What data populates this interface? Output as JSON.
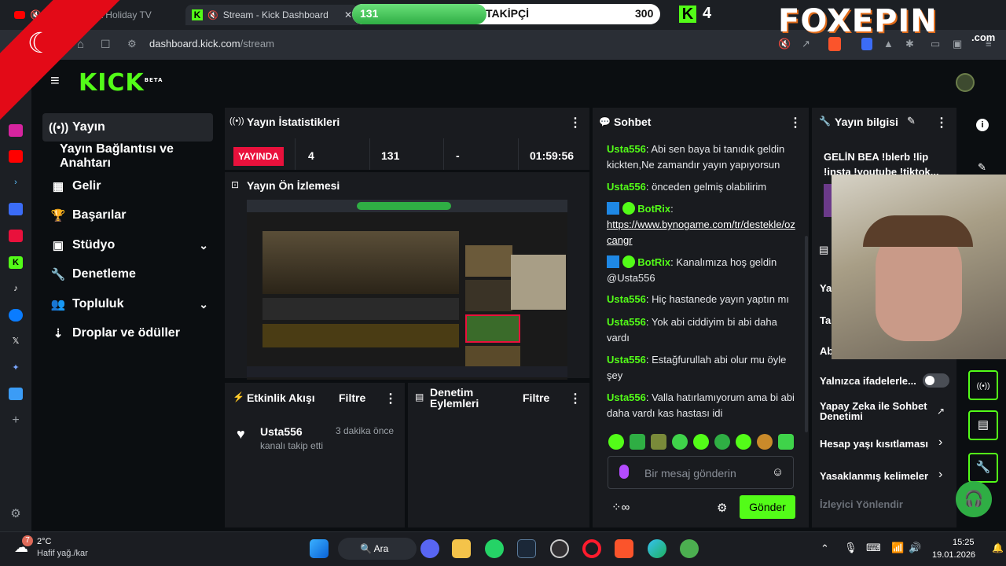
{
  "browser": {
    "tab1_title": "edicta Holiday TV",
    "tab2_title": "Stream - Kick Dashboard",
    "url_host": "dashboard.kick.com",
    "url_path": "/stream"
  },
  "overlay": {
    "follower_current": "131",
    "follower_label": "TAKİPÇİ",
    "follower_goal": "300",
    "follower_progress": 0.4367,
    "kick_count": "4",
    "brand": "FOXEPIN",
    "brand_domain": ".com"
  },
  "kick": {
    "logo": "KICK",
    "logo_badge": "BETA"
  },
  "nav": [
    {
      "label": "Yayın",
      "icon": "broadcast-icon"
    },
    {
      "label": "Yayın Bağlantısı ve Anahtarı",
      "icon": ""
    },
    {
      "label": "Gelir",
      "icon": "chart-icon"
    },
    {
      "label": "Başarılar",
      "icon": "trophy-icon"
    },
    {
      "label": "Stüdyo",
      "icon": "studio-icon"
    },
    {
      "label": "Denetleme",
      "icon": "wrench-icon"
    },
    {
      "label": "Topluluk",
      "icon": "community-icon"
    },
    {
      "label": "Droplar ve ödüller",
      "icon": "drops-icon"
    }
  ],
  "stats": {
    "title": "Yayın İstatistikleri",
    "live_badge": "YAYINDA",
    "viewers": "4",
    "followers": "131",
    "subs": "-",
    "duration": "01:59:56"
  },
  "preview": {
    "title": "Yayın Ön İzlemesi"
  },
  "activity": {
    "title": "Etkinlik Akışı",
    "filter": "Filtre",
    "item_user": "Usta556",
    "item_time": "3 dakika önce",
    "item_action": "kanalı takip etti"
  },
  "modactions": {
    "title_line1": "Denetim",
    "title_line2": "Eylemleri",
    "filter": "Filtre"
  },
  "chat": {
    "title": "Sohbet",
    "messages": [
      {
        "user": "Usta556",
        "text": ": Abi sen baya bi tanıdık geldin kickten,Ne zamandır yayın yapıyorsun"
      },
      {
        "user": "Usta556",
        "text": ": önceden gelmiş olabilirim"
      },
      {
        "user": "BotRix",
        "text": ":",
        "link": "https://www.bynogame.com/tr/destekle/ozcangr"
      },
      {
        "user": "BotRix",
        "text": ": Kanalımıza hoş geldin @Usta556"
      },
      {
        "user": "Usta556",
        "text": ": Hiç hastanede yayın yaptın mı"
      },
      {
        "user": "Usta556",
        "text": ": Yok abi ciddiyim bi abi daha vardı"
      },
      {
        "user": "Usta556",
        "text": ": Estağfurullah abi olur mu öyle şey"
      },
      {
        "user": "Usta556",
        "text": ": Valla hatırlamıyorum ama bi abi daha vardı kas hastası idi"
      }
    ],
    "input_placeholder": "Bir mesaj gönderin",
    "send": "Gönder"
  },
  "info": {
    "title": "Yayın bilgisi",
    "stream_title": "GELİN BEA !blerb !lip !insta !youtube !tiktok...",
    "emote_only": "Yalnızca ifadelerle...",
    "ai_mod": "Yapay Zeka ile Sohbet Denetimi",
    "age_restrict": "Hesap yaşı kısıtlaması",
    "banned_words": "Yasaklanmış kelimeler",
    "redirect": "İzleyici Yönlendir",
    "partial1": "Ya",
    "partial2": "Ta",
    "partial3": "Ab"
  },
  "taskbar": {
    "weather_temp": "2°C",
    "weather_desc": "Hafif yağ./kar",
    "weather_badge": "7",
    "search": "Ara",
    "time": "15:25",
    "date": "19.01.2026"
  }
}
